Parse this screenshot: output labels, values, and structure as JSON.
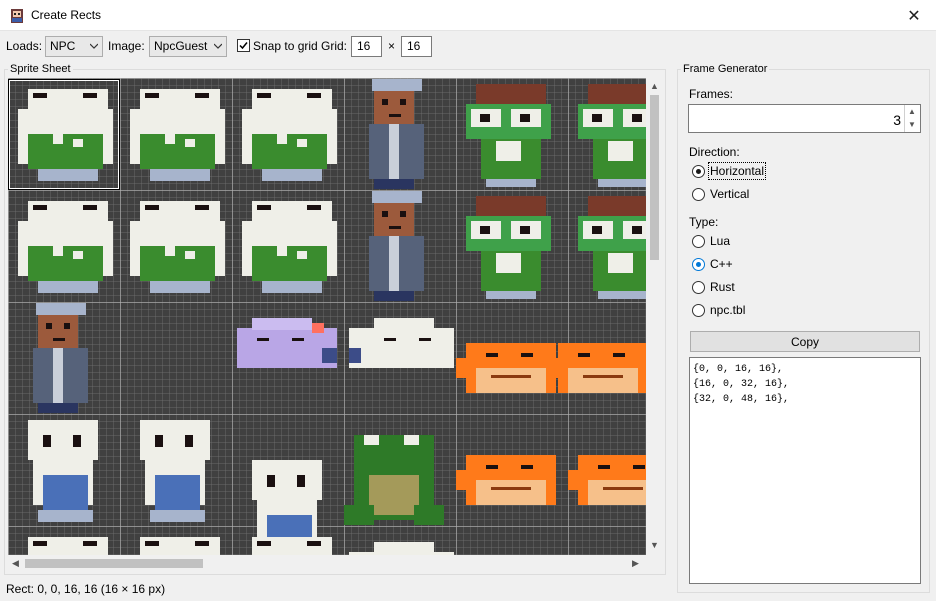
{
  "window": {
    "title": "Create Rects",
    "close_glyph": "✕"
  },
  "toolbar": {
    "loads_label": "Loads:",
    "loads_value": "NPC",
    "image_label": "Image:",
    "image_value": "NpcGuest",
    "snap_label": "Snap to grid",
    "snap_checked": true,
    "grid_label": "Grid:",
    "grid_w": "16",
    "times": "×",
    "grid_h": "16"
  },
  "sprite_sheet": {
    "label": "Sprite Sheet",
    "grid_color": "#b4b4b4",
    "background": "#404040",
    "sprites": [
      {
        "name": "white-blob-green-1",
        "kind": "blob"
      },
      {
        "name": "white-blob-green-2",
        "kind": "blob"
      },
      {
        "name": "white-blob-green-side",
        "kind": "blob"
      },
      {
        "name": "old-man-front",
        "kind": "man"
      },
      {
        "name": "green-goggle-hat-1",
        "kind": "goggle"
      },
      {
        "name": "green-goggle-hat-2",
        "kind": "goggle"
      },
      {
        "name": "purple-slug",
        "kind": "purple"
      },
      {
        "name": "white-slug",
        "kind": "whiteslug"
      },
      {
        "name": "orange-fish",
        "kind": "orange"
      },
      {
        "name": "white-ghost",
        "kind": "ghost"
      },
      {
        "name": "green-frog",
        "kind": "frog"
      }
    ]
  },
  "frame_generator": {
    "label": "Frame Generator",
    "frames_label": "Frames:",
    "frames_value": "3",
    "direction_label": "Direction:",
    "direction_options": [
      "Horizontal",
      "Vertical"
    ],
    "direction_selected": "Horizontal",
    "type_label": "Type:",
    "type_options": [
      "Lua",
      "C++",
      "Rust",
      "npc.tbl"
    ],
    "type_selected": "C++",
    "copy_label": "Copy",
    "output_lines": [
      "{0, 0, 16, 16},",
      "{16, 0, 32, 16},",
      "{32, 0, 48, 16},"
    ]
  },
  "status": {
    "text": "Rect:  0,  0,  16,  16   (16 × 16 px)"
  },
  "colors": {
    "accent": "#0078d7",
    "window_bg": "#f0f0f0"
  }
}
